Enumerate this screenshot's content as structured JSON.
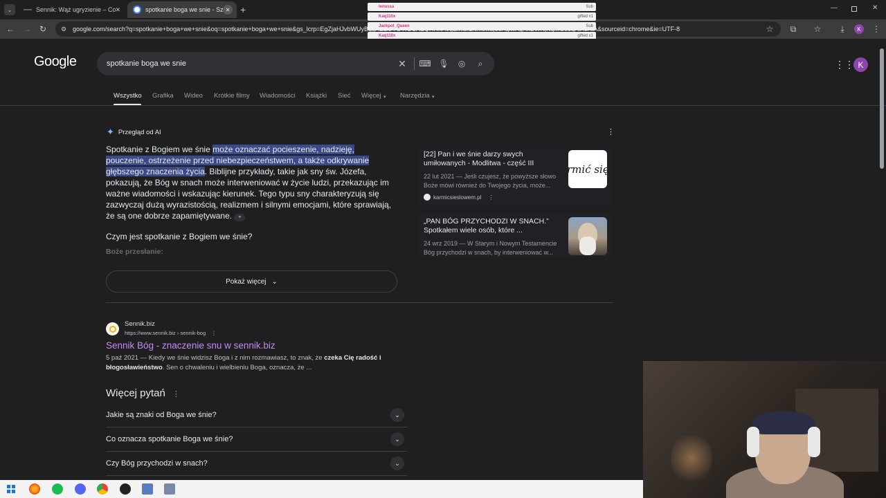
{
  "browser": {
    "tabs": [
      {
        "title": "Sennik: Wąż ugryzienie – Co oz",
        "active": false
      },
      {
        "title": "spotkanie boga we snie - Szuk",
        "active": true
      }
    ],
    "url": "google.com/search?q=spotkanie+boga+we+snie&oq=spotkanie+boga+we+snie&gs_lcrp=EgZjaHJvbWUyBggAEEUYOTIGCAEQRRhA0gEIMzI1NmowajeoAgiwAgHxBWNjNqMGo3qAlAsAIA&sourceid=chrome&ie=UTF-8",
    "profile_initial": "K"
  },
  "chat_overlay": [
    {
      "name": "lenussa",
      "value": "Sub"
    },
    {
      "name": "Kaq110x",
      "value": "gifted x1"
    },
    {
      "name": "Jackpot_Queen",
      "value": "Sub"
    },
    {
      "name": "Kaq110x",
      "value": "gifted x1"
    }
  ],
  "google": {
    "logo": "Google",
    "query": "spotkanie boga we snie",
    "nav_tabs": [
      "Wszystko",
      "Grafika",
      "Wideo",
      "Krótkie filmy",
      "Wiadomości",
      "Książki",
      "Sieć",
      "Więcej",
      "Narzędzia"
    ],
    "profile_initial": "K"
  },
  "ai_overview": {
    "header": "Przegląd od AI",
    "text_pre": "Spotkanie z Bogiem we śnie ",
    "text_highlight": "może oznaczać pocieszenie, nadzieję, pouczenie, ostrzeżenie przed niebezpieczeństwem, a także odkrywanie głębszego znaczenia życia",
    "text_post": ". Biblijne przykłady, takie jak sny św. Józefa, pokazują, że Bóg w snach może interweniować w życie ludzi, przekazując im ważne wiadomości i wskazując kierunek. Tego typu sny charakteryzują się zazwyczaj dużą wyrazistością, realizmem i silnymi emocjami, które sprawiają, że są one dobrze zapamiętywane.",
    "question": "Czym jest spotkanie z Bogiem we śnie?",
    "subheading": "Boże przesłanie:",
    "show_more": "Pokaż więcej",
    "sources": [
      {
        "title": "[22] Pan i we śnie darzy swych umiłowanych - Modlitwa - część III",
        "snippet": "22 lut 2021 — Jeśli czujesz, że powyższe słowo Boże mówi również do Twojego życia, może...",
        "site": "karmicsieslowem.pl",
        "thumb_text": "rmić się"
      },
      {
        "title": "„PAN BÓG PRZYCHODZI W SNACH.” Spotkałem wiele osób, które ...",
        "snippet": "24 wrz 2019 — W Starym i Nowym Testamencie Bóg przychodzi w snach, by interweniować w..."
      }
    ]
  },
  "result": {
    "site": "Sennik.biz",
    "url": "https://www.sennik.biz › sennik-bog",
    "title": "Sennik Bóg - znaczenie snu w sennik.biz",
    "date": "5 paź 2021 — Kiedy we śnie widzisz Boga i z nim rozmawiasz, to znak, że ",
    "bold": "czeka Cię radość i błogosławieństwo",
    "snippet_end": ". Sen o chwaleniu i wielbieniu Boga, oznacza, że ..."
  },
  "people_also_ask": {
    "heading": "Więcej pytań",
    "questions": [
      "Jakie są znaki od Boga we śnie?",
      "Co oznacza spotkanie Boga we śnie?",
      "Czy Bóg przychodzi w snach?"
    ]
  }
}
